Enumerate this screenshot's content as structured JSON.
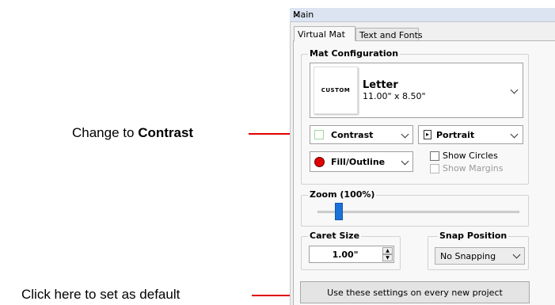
{
  "annotations": {
    "change_prefix": "Change to ",
    "change_bold": "Contrast",
    "default_hint": "Click here to set as default"
  },
  "panel": {
    "title": "Main",
    "close_symbol": "×",
    "tabs": [
      "Virtual Mat",
      "Text and Fonts"
    ]
  },
  "mat_config": {
    "group_label": "Mat Configuration",
    "custom_badge": "CUSTOM",
    "size_name": "Letter",
    "size_dims": "11.00\" x 8.50\"",
    "contrast_label": "Contrast",
    "orientation_label": "Portrait",
    "fill_label": "Fill/Outline",
    "show_circles": "Show Circles",
    "show_margins": "Show Margins",
    "show_circles_checked": false,
    "show_margins_checked": false
  },
  "zoom": {
    "label": "Zoom (100%)",
    "level": 100
  },
  "caret": {
    "label": "Caret Size",
    "value": "1.00\""
  },
  "snap": {
    "label": "Snap Position",
    "value": "No Snapping"
  },
  "default_button": "Use these settings on every new project",
  "colors": {
    "arrow": "#e00000",
    "fill_dot": "#e00000",
    "slider_thumb": "#1a73d9"
  }
}
